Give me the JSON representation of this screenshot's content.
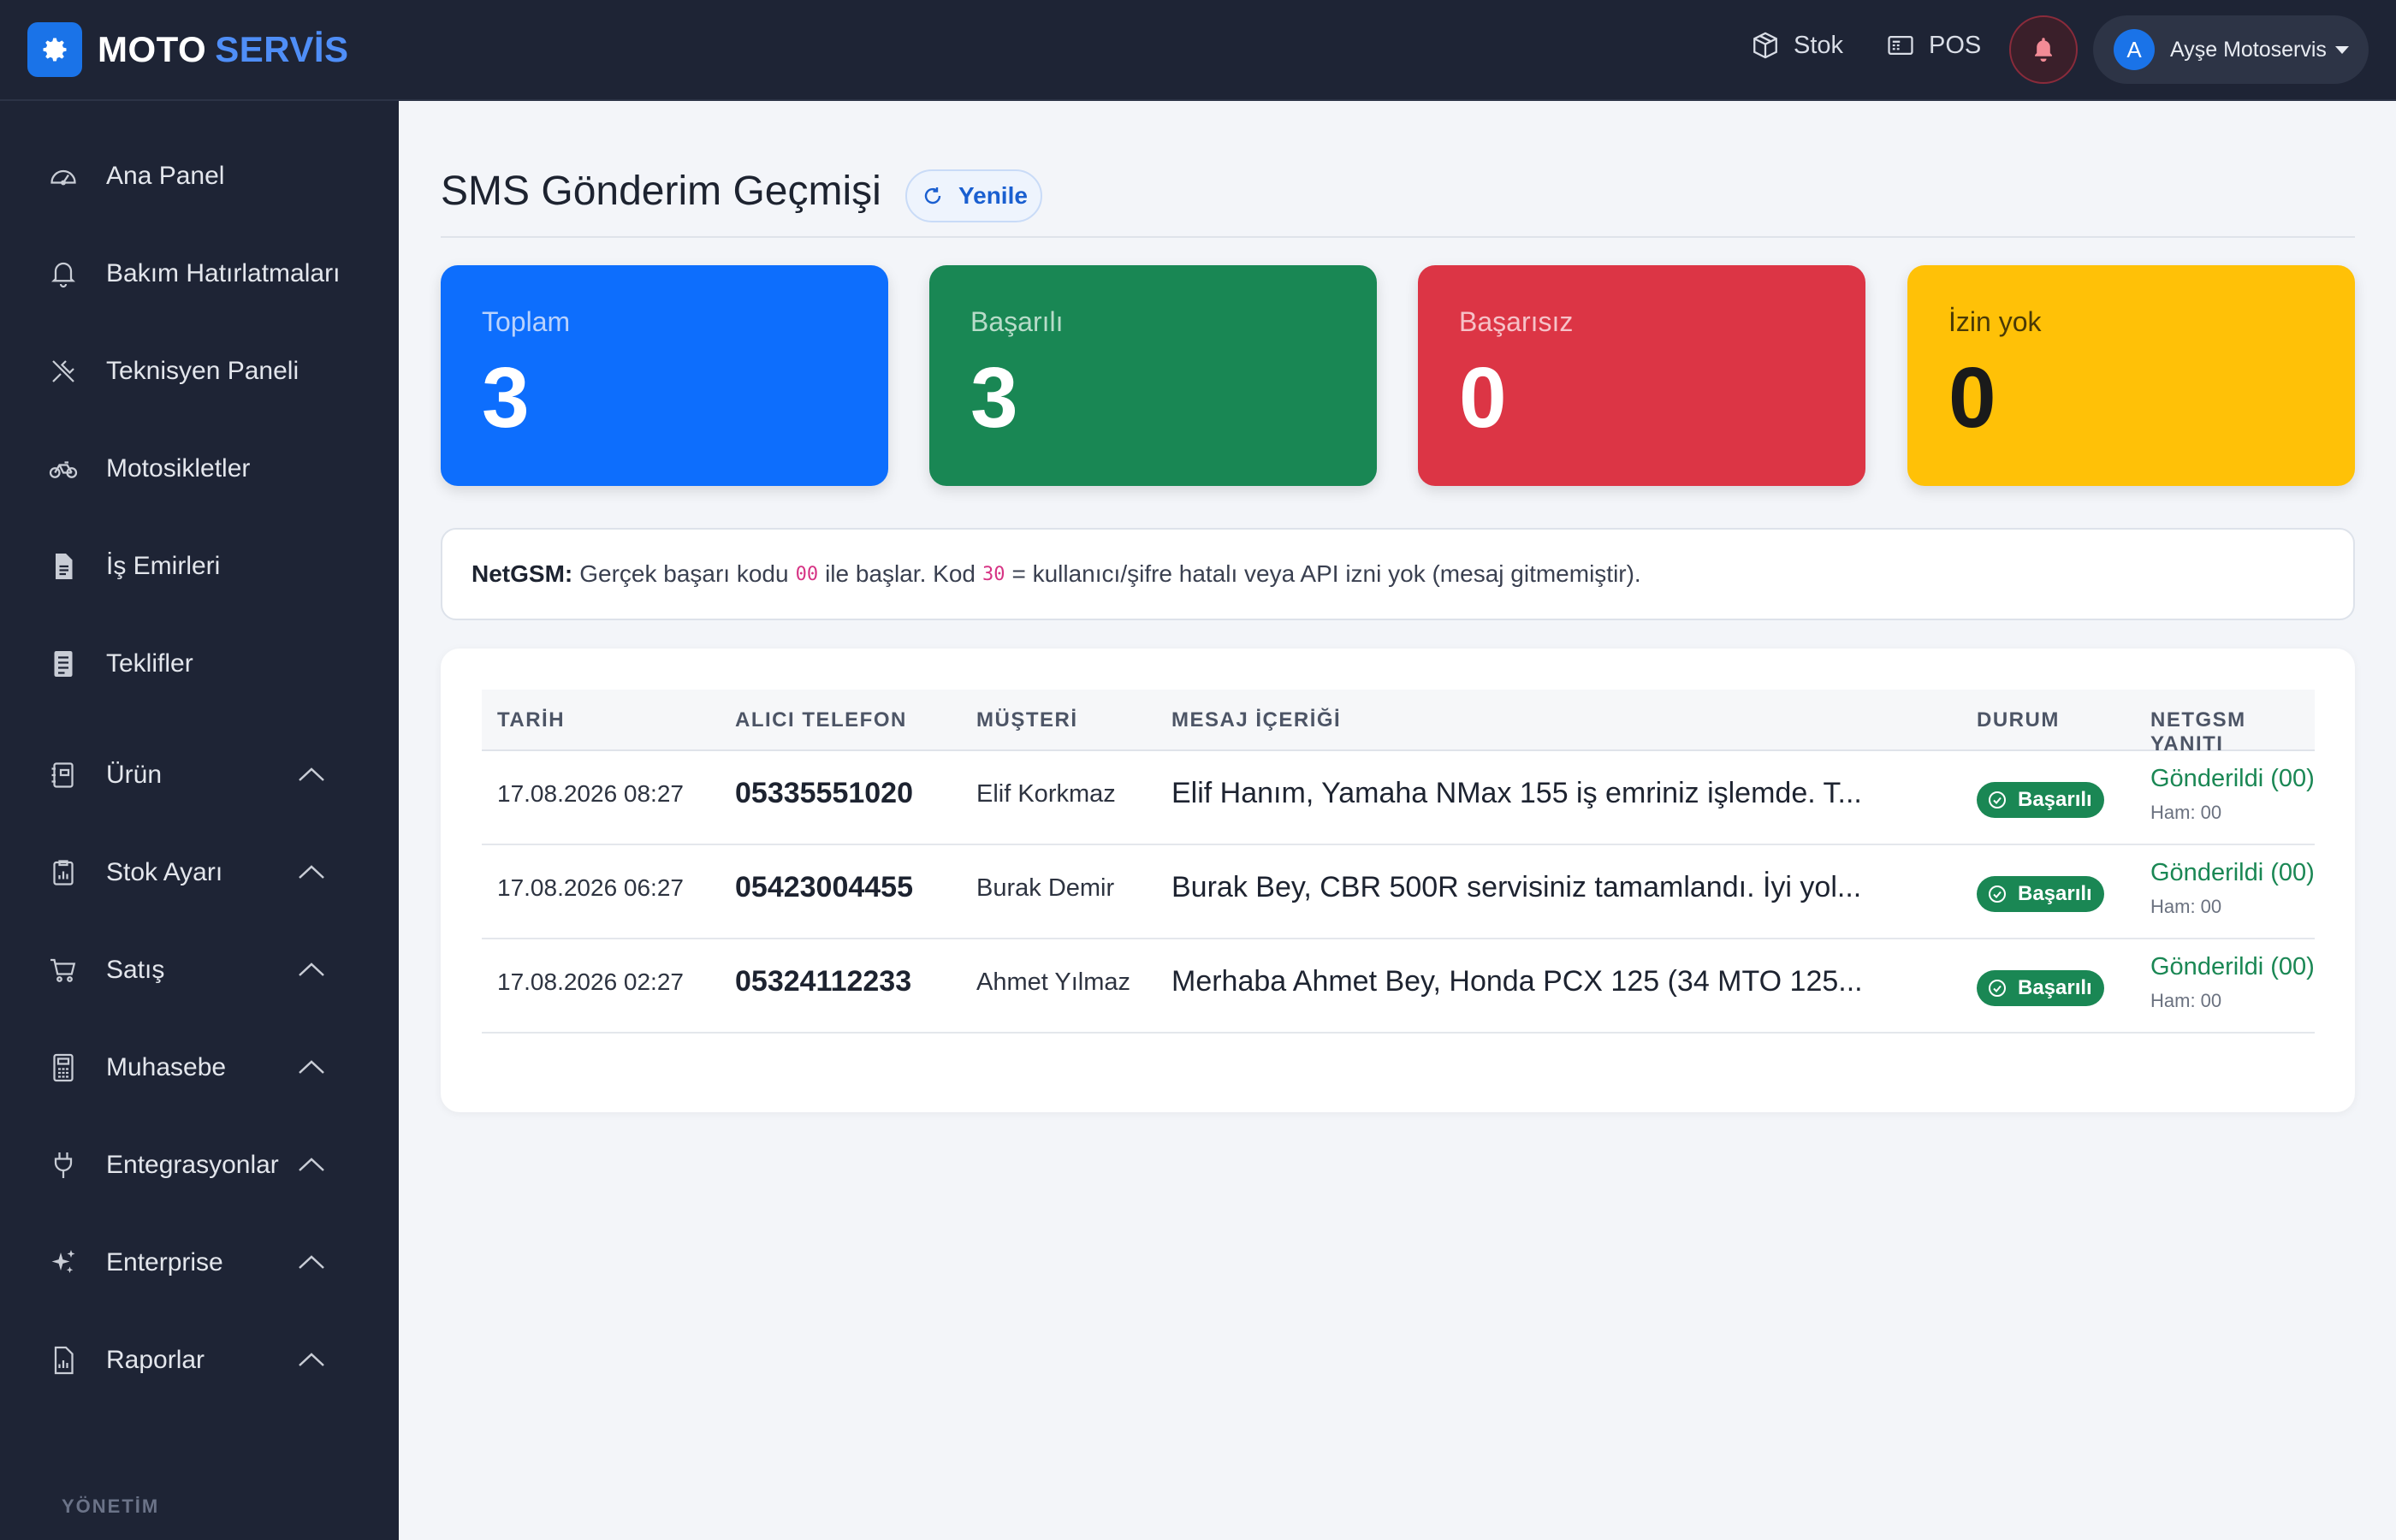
{
  "brand": {
    "name_part1": "MOTO",
    "name_part2": "SERVİS"
  },
  "topbar": {
    "stock_label": "Stok",
    "pos_label": "POS",
    "user_initial": "A",
    "user_name": "Ayşe Motoservis"
  },
  "sidebar": {
    "items": [
      {
        "label": "Ana Panel",
        "icon": "speedometer-icon"
      },
      {
        "label": "Bakım Hatırlatmaları",
        "icon": "bell-icon"
      },
      {
        "label": "Teknisyen Paneli",
        "icon": "tools-icon"
      },
      {
        "label": "Motosikletler",
        "icon": "bicycle-icon"
      },
      {
        "label": "İş Emirleri",
        "icon": "file-icon"
      },
      {
        "label": "Teklifler",
        "icon": "document-icon"
      },
      {
        "label": "Ürün",
        "icon": "journal-icon",
        "expandable": true
      },
      {
        "label": "Stok Ayarı",
        "icon": "clipboard-icon",
        "expandable": true
      },
      {
        "label": "Satış",
        "icon": "cart-icon",
        "expandable": true
      },
      {
        "label": "Muhasebe",
        "icon": "calculator-icon",
        "expandable": true
      },
      {
        "label": "Entegrasyonlar",
        "icon": "plug-icon",
        "expandable": true
      },
      {
        "label": "Enterprise",
        "icon": "stars-icon",
        "expandable": true
      },
      {
        "label": "Raporlar",
        "icon": "report-icon",
        "expandable": true
      }
    ],
    "section_label": "YÖNETİM"
  },
  "page": {
    "title": "SMS Gönderim Geçmişi",
    "refresh_label": "Yenile"
  },
  "stats": [
    {
      "label": "Toplam",
      "value": "3",
      "color": "#0d6efd"
    },
    {
      "label": "Başarılı",
      "value": "3",
      "color": "#198754"
    },
    {
      "label": "Başarısız",
      "value": "0",
      "color": "#dc3545"
    },
    {
      "label": "İzin yok",
      "value": "0",
      "color": "#ffc107"
    }
  ],
  "info": {
    "prefix": "NetGSM:",
    "text1": "Gerçek başarı kodu",
    "code1": "00",
    "text2": "ile başlar. Kod",
    "code2": "30",
    "text3": "= kullanıcı/şifre hatalı veya API izni yok (mesaj gitmemiştir)."
  },
  "table": {
    "headers": [
      "TARİH",
      "ALICI TELEFON",
      "MÜŞTERİ",
      "MESAJ İÇERİĞİ",
      "DURUM",
      "NETGSM YANITI"
    ],
    "rows": [
      {
        "date": "17.08.2026 08:27",
        "phone": "05335551020",
        "customer": "Elif Korkmaz",
        "message": "Elif Hanım, Yamaha NMax 155 iş emriniz işlemde. T...",
        "status": "Başarılı",
        "response": "Gönderildi (00)",
        "raw": "Ham: 00"
      },
      {
        "date": "17.08.2026 06:27",
        "phone": "05423004455",
        "customer": "Burak Demir",
        "message": "Burak Bey, CBR 500R servisiniz tamamlandı. İyi yol...",
        "status": "Başarılı",
        "response": "Gönderildi (00)",
        "raw": "Ham: 00"
      },
      {
        "date": "17.08.2026 02:27",
        "phone": "05324112233",
        "customer": "Ahmet Yılmaz",
        "message": "Merhaba Ahmet Bey, Honda PCX 125 (34 MTO 125...",
        "status": "Başarılı",
        "response": "Gönderildi (00)",
        "raw": "Ham: 00"
      }
    ]
  }
}
